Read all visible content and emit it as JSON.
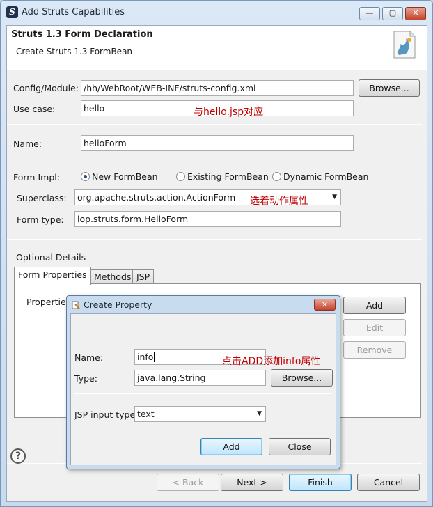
{
  "window": {
    "title": "Add Struts Capabilities",
    "controls": {
      "minimize": "—",
      "maximize": "▢",
      "close": "✕"
    }
  },
  "banner": {
    "title": "Struts 1.3 Form Declaration",
    "subtitle": "Create Struts 1.3 FormBean"
  },
  "form": {
    "config_label": "Config/Module:",
    "config_value": "/hh/WebRoot/WEB-INF/struts-config.xml",
    "browse_label": "Browse...",
    "usecase_label": "Use case:",
    "usecase_value": "hello",
    "name_label": "Name:",
    "name_value": "helloForm",
    "impl_label": "Form Impl:",
    "impl_options": [
      "New FormBean",
      "Existing FormBean",
      "Dynamic FormBean"
    ],
    "impl_selected": "New FormBean",
    "superclass_label": "Superclass:",
    "superclass_value": "org.apache.struts.action.ActionForm",
    "formtype_label": "Form type:",
    "formtype_value": "lop.struts.form.HelloForm"
  },
  "optional": {
    "title": "Optional Details",
    "tabs": [
      "Form Properties",
      "Methods",
      "JSP"
    ],
    "active_tab": "Form Properties",
    "properties_label": "Properties:",
    "add_label": "Add",
    "edit_label": "Edit",
    "remove_label": "Remove"
  },
  "dialog": {
    "title": "Create Property",
    "close": "✕",
    "name_label": "Name:",
    "name_value": "info",
    "type_label": "Type:",
    "type_value": "java.lang.String",
    "browse_label": "Browse...",
    "jsp_label": "JSP input type",
    "jsp_value": "text",
    "add_label": "Add",
    "close_label": "Close"
  },
  "annotations": {
    "usecase_note": "与hello.jsp对应",
    "superclass_note": "选着动作属性",
    "dialog_note": "点击ADD添加info属性"
  },
  "footer": {
    "help": "?",
    "back_label": "< Back",
    "next_label": "Next >",
    "finish_label": "Finish",
    "cancel_label": "Cancel"
  }
}
